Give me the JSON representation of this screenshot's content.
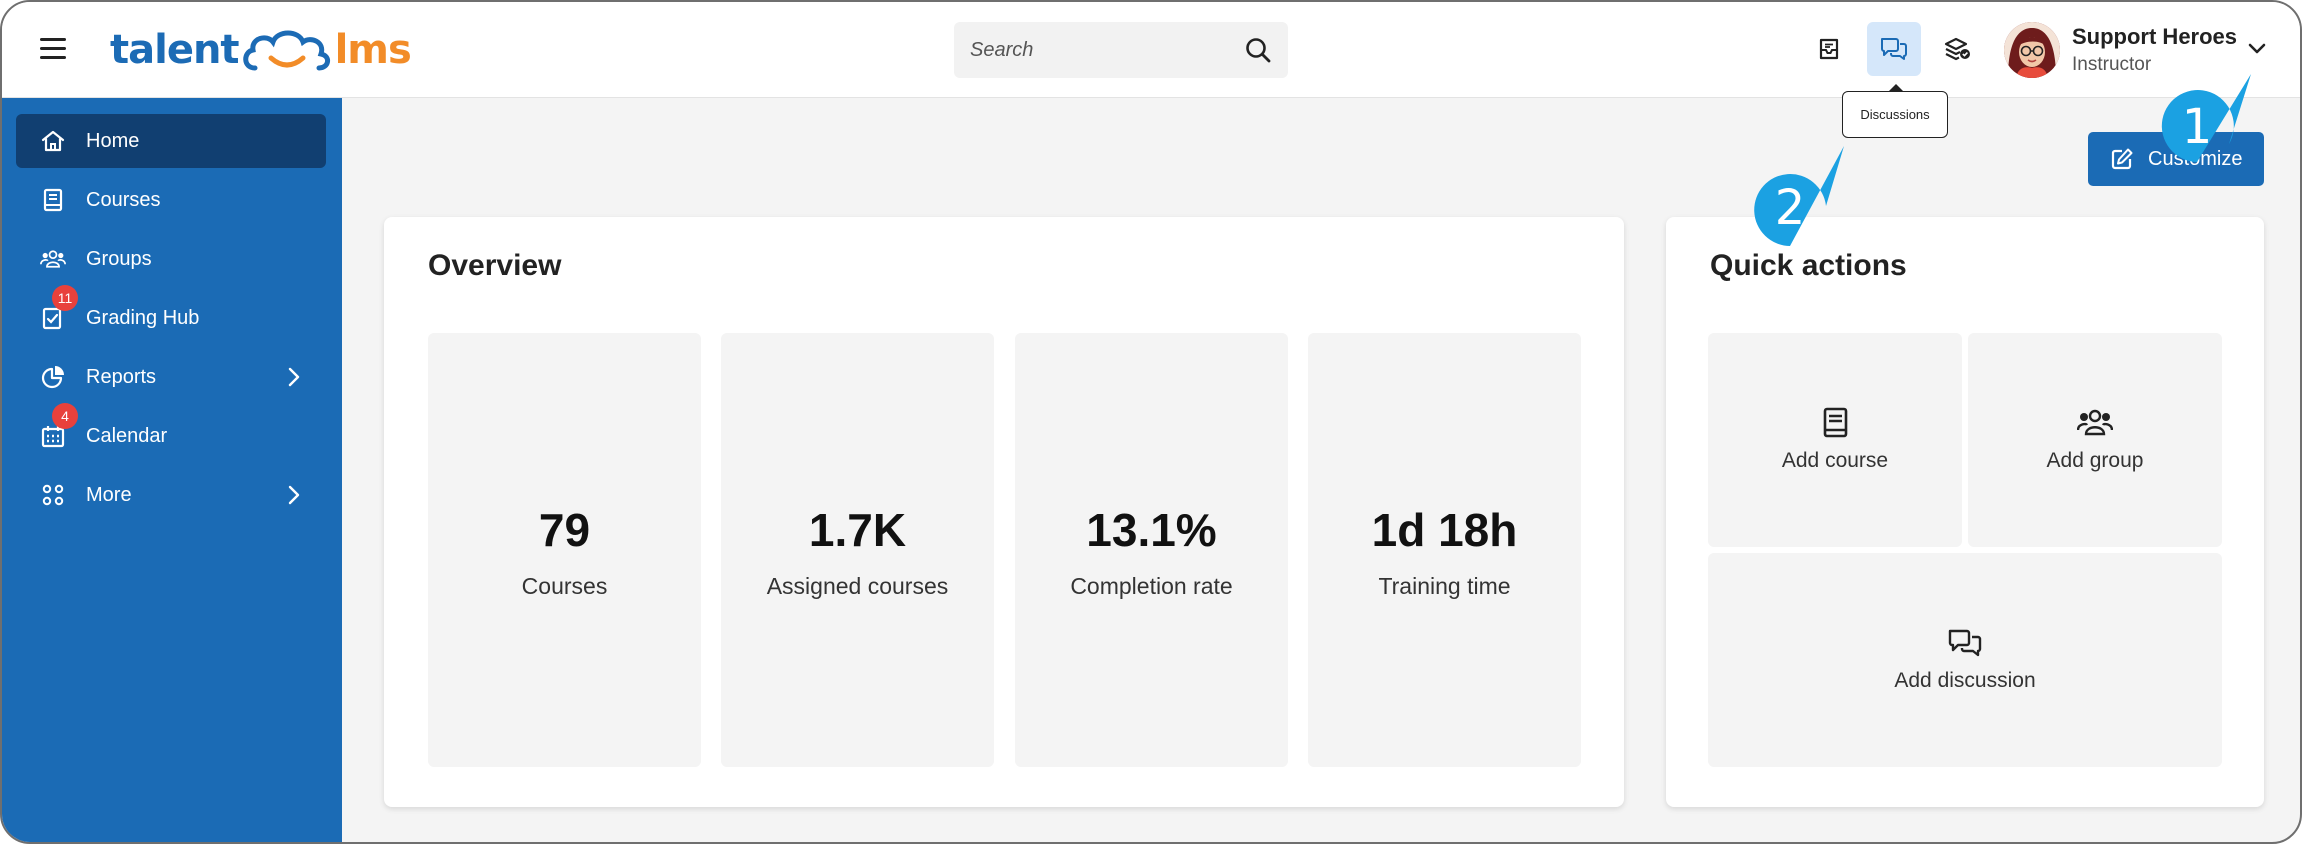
{
  "header": {
    "logo": {
      "part1": "talent",
      "part2": "lms"
    },
    "search": {
      "placeholder": "Search"
    },
    "icons": [
      "menu-icon",
      "inbox-icon",
      "discussions-icon",
      "catalog-icon",
      "search-icon",
      "chevron-down-icon"
    ],
    "tooltip": "Discussions",
    "user": {
      "name": "Support Heroes",
      "role": "Instructor"
    }
  },
  "sidebar": {
    "items": [
      {
        "label": "Home",
        "icon": "home-icon",
        "active": true
      },
      {
        "label": "Courses",
        "icon": "book-icon"
      },
      {
        "label": "Groups",
        "icon": "groups-icon"
      },
      {
        "label": "Grading Hub",
        "icon": "grading-icon",
        "badge": "11"
      },
      {
        "label": "Reports",
        "icon": "pie-chart-icon",
        "has_submenu": true
      },
      {
        "label": "Calendar",
        "icon": "calendar-icon",
        "badge": "4"
      },
      {
        "label": "More",
        "icon": "grid-icon",
        "has_submenu": true
      }
    ]
  },
  "main": {
    "customize_label": "Customize",
    "overview": {
      "title": "Overview",
      "stats": [
        {
          "value": "79",
          "label": "Courses"
        },
        {
          "value": "1.7K",
          "label": "Assigned courses"
        },
        {
          "value": "13.1%",
          "label": "Completion rate"
        },
        {
          "value": "1d 18h",
          "label": "Training time"
        }
      ]
    },
    "quick_actions": {
      "title": "Quick actions",
      "items": [
        {
          "label": "Add course",
          "icon": "book-icon"
        },
        {
          "label": "Add group",
          "icon": "groups-icon"
        },
        {
          "label": "Add discussion",
          "icon": "discussions-icon"
        }
      ]
    }
  },
  "callouts": [
    "1",
    "2"
  ],
  "colors": {
    "brand_blue": "#1b6bb5",
    "sidebar_active": "#113f71",
    "logo_orange": "#f28c28",
    "badge_red": "#e8413c",
    "callout_blue": "#1ba1e2",
    "discussions_highlight": "#d5e7fa"
  }
}
